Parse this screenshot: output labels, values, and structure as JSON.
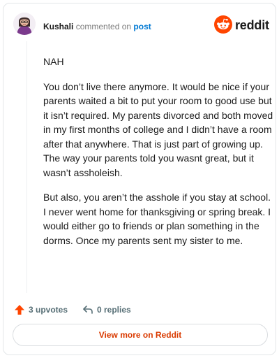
{
  "header": {
    "username": "Kushali",
    "verb": "commented on",
    "post_link": "post",
    "brand_name": "reddit",
    "brand_color": "#ff4500"
  },
  "comment": {
    "paragraphs": [
      "NAH",
      "You don’t live there anymore. It would be nice if your parents waited a bit to put your room to good use but it isn’t required. My parents divorced and both moved in my first months of college and I didn’t have a room after that anywhere. That is just part of growing up. The way your parents told you wasnt great, but it wasn’t assholeish.",
      "But also, you aren’t the asshole if you stay at school. I never went home for thanksgiving or spring break. I would either go to friends or plan something in the dorms. Once my parents sent my sister to me."
    ]
  },
  "actions": {
    "upvotes_label": "3 upvotes",
    "replies_label": "0 replies",
    "upvote_icon": "arrow-up-icon",
    "reply_icon": "reply-icon"
  },
  "footer": {
    "view_button_label": "View more on Reddit",
    "accent_color": "#d93a00"
  }
}
